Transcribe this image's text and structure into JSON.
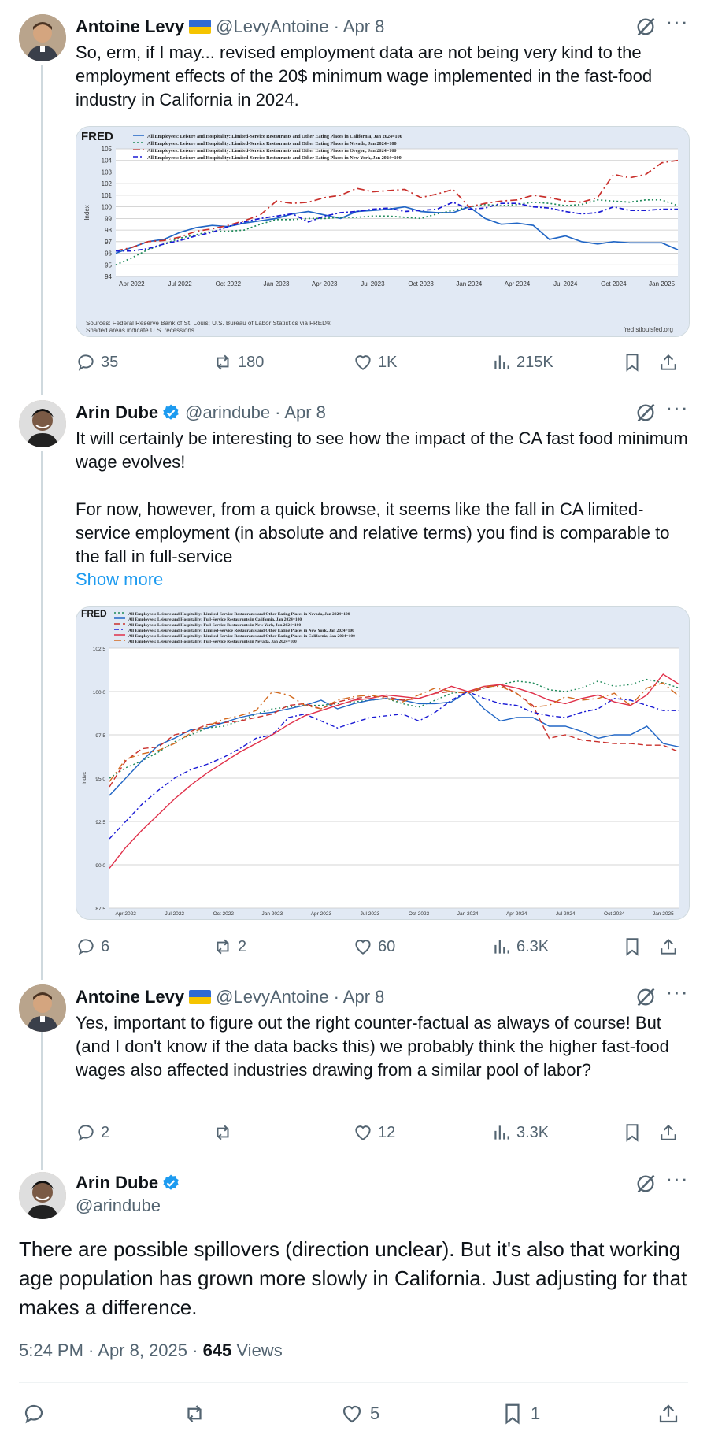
{
  "tweets": [
    {
      "author": "Antoine Levy",
      "handle": "@LevyAntoine",
      "date": "· Apr 8",
      "text": "So, erm, if I may... revised employment data are not being very kind to the employment effects of the 20$ minimum wage implemented in the fast-food industry in California in 2024.",
      "stats": {
        "replies": "35",
        "reposts": "180",
        "likes": "1K",
        "views": "215K"
      }
    },
    {
      "author": "Arin Dube",
      "handle": "@arindube",
      "date": "· Apr 8",
      "text": "It will certainly be interesting to see how the impact of the CA fast food minimum wage evolves!\n\nFor now, however, from a quick browse, it seems like the fall in CA limited-service employment (in absolute and relative terms) you find is comparable to the fall in full-service",
      "show_more": "Show more",
      "stats": {
        "replies": "6",
        "reposts": "2",
        "likes": "60",
        "views": "6.3K"
      }
    },
    {
      "author": "Antoine Levy",
      "handle": "@LevyAntoine",
      "date": "· Apr 8",
      "text": "Yes, important to figure out the right counter-factual as always of course! But (and I don't know if the data backs this) we probably think the higher fast-food wages also affected industries drawing from a similar pool of labor?",
      "stats": {
        "replies": "2",
        "reposts": "",
        "likes": "12",
        "views": "3.3K"
      }
    }
  ],
  "main_tweet": {
    "author": "Arin Dube",
    "handle": "@arindube",
    "text": "There are possible spillovers (direction unclear). But it's also that working age population has grown more slowly in California. Just adjusting for that makes a difference.",
    "time": "5:24 PM · Apr 8, 2025 · ",
    "views_count": "645",
    "views_label": " Views",
    "likes": "5",
    "bookmarks": "1"
  },
  "colors": {
    "link": "#1d9bf0",
    "muted": "#536471",
    "verified": "#1d9bf0",
    "chart_bg": "#e1e9f4"
  },
  "icons": [
    "reply-icon",
    "repost-icon",
    "like-icon",
    "views-icon",
    "bookmark-icon",
    "share-icon",
    "grok-icon",
    "more-icon",
    "verified-icon"
  ],
  "chart_data": [
    {
      "type": "line",
      "brand": "FRED",
      "ylabel": "Index",
      "ylim": [
        94,
        105
      ],
      "yticks": [
        "105",
        "104",
        "103",
        "102",
        "101",
        "100",
        "99",
        "98",
        "97",
        "96",
        "95",
        "94"
      ],
      "xticks": [
        "Apr 2022",
        "Jul 2022",
        "Oct 2022",
        "Jan 2023",
        "Apr 2023",
        "Jul 2023",
        "Oct 2023",
        "Jan 2024",
        "Apr 2024",
        "Jul 2024",
        "Oct 2024",
        "Jan 2025"
      ],
      "legend": [
        "All Employees: Leisure and Hospitality: Limited-Service Restaurants and Other Eating Places in California, Jan 2024=100",
        "All Employees: Leisure and Hospitality: Limited-Service Restaurants and Other Eating Places in Nevada, Jan 2024=100",
        "All Employees: Leisure and Hospitality: Limited-Service Restaurants and Other Eating Places in Oregon, Jan 2024=100",
        "All Employees: Leisure and Hospitality: Limited-Service Restaurants and Other Eating Places in New York, Jan 2024=100"
      ],
      "source": "Sources: Federal Reserve Bank of St. Louis; U.S. Bureau of Labor Statistics via FRED®",
      "note": "Shaded areas indicate U.S. recessions.",
      "url": "fred.stlouisfed.org",
      "series": [
        {
          "color": "#2166c5",
          "dash": "",
          "values": [
            96.0,
            96.5,
            97.0,
            97.2,
            97.8,
            98.2,
            98.4,
            98.3,
            98.6,
            98.8,
            99.0,
            99.4,
            99.6,
            99.3,
            99.0,
            99.6,
            99.7,
            99.8,
            100.0,
            99.6,
            99.5,
            99.5,
            100.0,
            99.0,
            98.5,
            98.6,
            98.4,
            97.2,
            97.5,
            97.0,
            96.8,
            97.0,
            96.9,
            96.9,
            96.9,
            96.3
          ]
        },
        {
          "color": "#1f8a5a",
          "dash": "2,3",
          "values": [
            95.0,
            95.6,
            96.3,
            96.8,
            97.3,
            97.6,
            97.9,
            97.9,
            98.0,
            98.5,
            98.9,
            98.9,
            99.0,
            99.0,
            99.1,
            99.1,
            99.2,
            99.2,
            99.1,
            99.0,
            99.4,
            99.7,
            100.0,
            100.2,
            100.1,
            100.2,
            100.4,
            100.3,
            100.1,
            100.2,
            100.6,
            100.5,
            100.4,
            100.6,
            100.6,
            100.1
          ]
        },
        {
          "color": "#c9302c",
          "dash": "9,4,2,4",
          "values": [
            96.2,
            96.5,
            97.0,
            97.1,
            97.4,
            97.9,
            98.1,
            98.4,
            98.8,
            99.3,
            100.5,
            100.3,
            100.4,
            100.8,
            101.0,
            101.6,
            101.3,
            101.4,
            101.5,
            100.8,
            101.1,
            101.5,
            100.0,
            100.3,
            100.5,
            100.6,
            101.0,
            100.8,
            100.5,
            100.4,
            100.8,
            102.8,
            102.5,
            102.8,
            103.8,
            104.0
          ]
        },
        {
          "color": "#1a1ad4",
          "dash": "6,3,2,3",
          "values": [
            96.2,
            96.2,
            96.4,
            96.8,
            97.1,
            97.5,
            97.8,
            98.3,
            98.7,
            99.0,
            99.2,
            99.4,
            98.7,
            99.2,
            99.5,
            99.6,
            99.8,
            99.9,
            99.6,
            99.7,
            99.8,
            100.4,
            99.8,
            99.9,
            100.3,
            100.3,
            100.0,
            99.9,
            99.6,
            99.4,
            99.5,
            100.0,
            99.7,
            99.7,
            99.8,
            99.8
          ]
        }
      ]
    },
    {
      "type": "line",
      "brand": "FRED",
      "ylabel": "Index",
      "ylim": [
        87.5,
        102.5
      ],
      "yticks": [
        "102.5",
        "100.0",
        "97.5",
        "95.0",
        "92.5",
        "90.0",
        "87.5"
      ],
      "xticks": [
        "Apr 2022",
        "Jul 2022",
        "Oct 2022",
        "Jan 2023",
        "Apr 2023",
        "Jul 2023",
        "Oct 2023",
        "Jan 2024",
        "Apr 2024",
        "Jul 2024",
        "Oct 2024",
        "Jan 2025"
      ],
      "legend": [
        "All Employees: Leisure and Hospitality: Limited-Service Restaurants and Other Eating Places in Nevada, Jan 2024=100",
        "All Employees: Leisure and Hospitality: Full-Service Restaurants in California, Jan 2024=100",
        "All Employees: Leisure and Hospitality: Full-Service Restaurants in New York, Jan 2024=100",
        "All Employees: Leisure and Hospitality: Limited-Service Restaurants and Other Eating Places in New York, Jan 2024=100",
        "All Employees: Leisure and Hospitality: Limited-Service Restaurants and Other Eating Places in California, Jan 2024=100",
        "All Employees: Leisure and Hospitality: Full-Service Restaurants in Nevada, Jan 2024=100"
      ],
      "series": [
        {
          "color": "#1f8a5a",
          "dash": "2,3",
          "values": [
            95.0,
            95.6,
            96.0,
            96.5,
            97.1,
            97.5,
            97.9,
            98.0,
            98.3,
            98.7,
            99.0,
            99.1,
            99.2,
            99.2,
            99.3,
            99.4,
            99.5,
            99.6,
            99.3,
            99.1,
            99.5,
            99.9,
            100.0,
            100.2,
            100.4,
            100.6,
            100.5,
            100.1,
            100.0,
            100.2,
            100.6,
            100.3,
            100.4,
            100.7,
            100.5,
            100.2
          ]
        },
        {
          "color": "#2166c5",
          "dash": "",
          "values": [
            94.0,
            95.0,
            96.0,
            96.9,
            97.3,
            97.8,
            97.9,
            98.2,
            98.5,
            98.7,
            98.8,
            99.0,
            99.2,
            99.5,
            99.0,
            99.3,
            99.5,
            99.6,
            99.5,
            99.3,
            99.3,
            99.4,
            100.0,
            99.0,
            98.3,
            98.5,
            98.5,
            98.0,
            98.0,
            97.7,
            97.3,
            97.5,
            97.5,
            98.0,
            97.0,
            96.8
          ]
        },
        {
          "color": "#c9302c",
          "dash": "7,4",
          "values": [
            94.5,
            96.0,
            96.7,
            96.8,
            97.5,
            97.7,
            98.1,
            98.2,
            98.3,
            98.5,
            98.7,
            99.2,
            99.3,
            99.0,
            99.4,
            99.6,
            99.7,
            99.7,
            99.5,
            99.6,
            99.9,
            100.0,
            99.9,
            100.2,
            100.4,
            99.9,
            99.2,
            97.3,
            97.5,
            97.2,
            97.1,
            97.0,
            97.0,
            96.9,
            96.9,
            96.5
          ]
        },
        {
          "color": "#1a1ad4",
          "dash": "6,3,2,3",
          "values": [
            91.5,
            92.5,
            93.5,
            94.3,
            95.0,
            95.5,
            95.8,
            96.2,
            96.7,
            97.3,
            97.5,
            98.5,
            98.7,
            98.3,
            97.9,
            98.2,
            98.5,
            98.6,
            98.7,
            98.3,
            98.8,
            99.5,
            100.0,
            99.6,
            99.3,
            99.2,
            98.8,
            98.6,
            98.5,
            98.8,
            99.0,
            99.6,
            99.5,
            99.2,
            98.9,
            98.9
          ]
        },
        {
          "color": "#e0304a",
          "dash": "",
          "values": [
            89.8,
            91.0,
            92.0,
            92.9,
            93.8,
            94.6,
            95.3,
            95.9,
            96.5,
            97.0,
            97.5,
            98.1,
            98.6,
            98.9,
            99.2,
            99.5,
            99.6,
            99.8,
            99.7,
            99.6,
            99.9,
            100.3,
            100.0,
            100.3,
            100.4,
            100.2,
            99.9,
            99.5,
            99.3,
            99.6,
            99.8,
            99.4,
            99.2,
            99.8,
            101.0,
            100.4
          ]
        },
        {
          "color": "#d2691e",
          "dash": "9,4,2,4",
          "values": [
            94.8,
            96.1,
            96.4,
            96.6,
            97.0,
            97.6,
            98.0,
            98.4,
            98.6,
            98.9,
            100.0,
            99.8,
            99.2,
            99.0,
            99.5,
            99.7,
            99.8,
            99.6,
            99.4,
            99.8,
            100.2,
            100.0,
            99.9,
            100.3,
            100.3,
            99.9,
            99.1,
            99.2,
            99.7,
            99.5,
            99.6,
            99.9,
            99.2,
            100.2,
            100.5,
            99.7
          ]
        }
      ]
    }
  ]
}
